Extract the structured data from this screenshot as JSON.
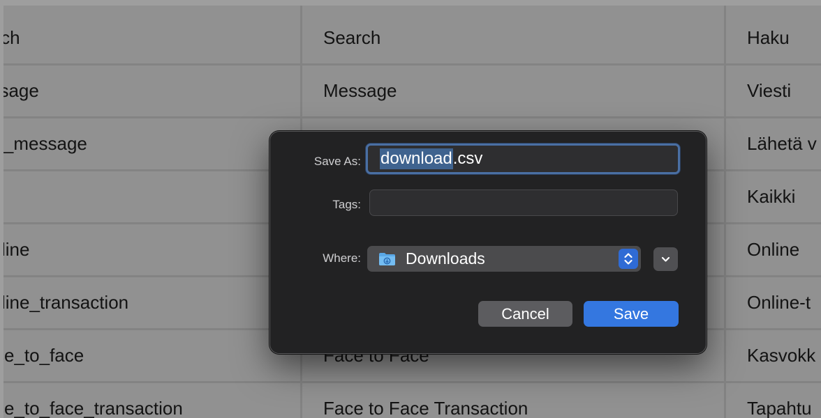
{
  "spreadsheet": {
    "rows": [
      {
        "key": "arch",
        "english": "Search",
        "finnish": "Haku"
      },
      {
        "key": "essage",
        "english": "Message",
        "finnish": "Viesti"
      },
      {
        "key": "nd_message",
        "english": "",
        "finnish": "Lähetä v"
      },
      {
        "key": "",
        "english": "",
        "finnish": "Kaikki"
      },
      {
        "key": "line",
        "english": "",
        "finnish": "Online"
      },
      {
        "key": "line_transaction",
        "english": "",
        "finnish": "Online-t"
      },
      {
        "key": "ce_to_face",
        "english": "Face to Face",
        "finnish": "Kasvokk"
      },
      {
        "key": "ce_to_face_transaction",
        "english": "Face to Face Transaction",
        "finnish": "Tapahtu"
      }
    ]
  },
  "save_dialog": {
    "save_as_label": "Save As:",
    "filename_selected": "download",
    "filename_extension": ".csv",
    "tags_label": "Tags:",
    "tags_value": "",
    "where_label": "Where:",
    "where_value": "Downloads",
    "cancel_label": "Cancel",
    "save_label": "Save",
    "colors": {
      "accent": "#3477e0",
      "selection": "#3f638f",
      "background": "#222223"
    },
    "icons": {
      "folder": "downloads-folder-icon",
      "stepper": "up-down-stepper-icon",
      "expand": "chevron-down-icon"
    }
  }
}
